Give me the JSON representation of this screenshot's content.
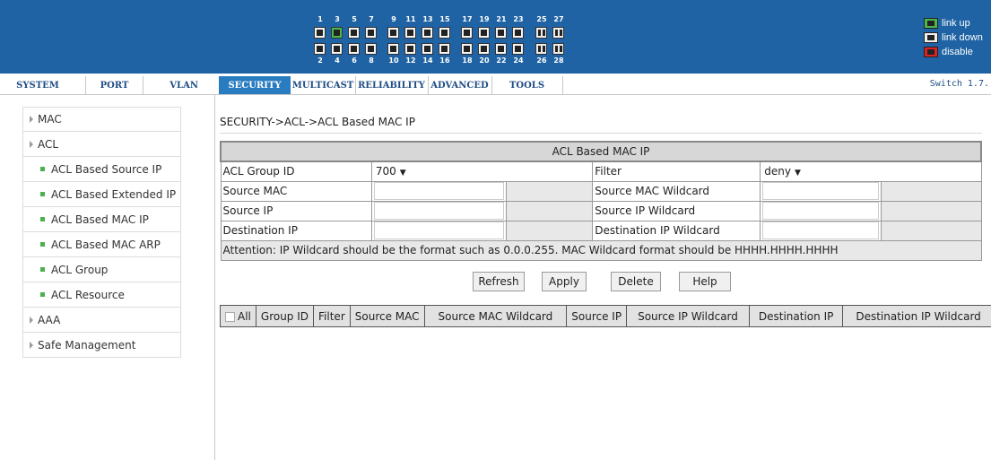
{
  "ports": {
    "top_numbers": [
      "1",
      "3",
      "5",
      "7",
      "9",
      "11",
      "13",
      "15",
      "17",
      "19",
      "21",
      "23",
      "25",
      "27"
    ],
    "bottom_numbers": [
      "2",
      "4",
      "6",
      "8",
      "10",
      "12",
      "14",
      "16",
      "18",
      "20",
      "22",
      "24",
      "26",
      "28"
    ],
    "link_up_ports": [
      "3"
    ]
  },
  "legend": {
    "up": "link up",
    "down": "link down",
    "disable": "disable"
  },
  "colors": {
    "banner": "#1f63a4",
    "active_tab": "#2a7cc0",
    "link_up": "#49b84d",
    "disable": "#e02121"
  },
  "nav": {
    "tabs": [
      "SYSTEM",
      "PORT",
      "VLAN",
      "SECURITY",
      "MULTICAST",
      "RELIABILITY",
      "ADVANCED",
      "TOOLS"
    ],
    "active": "SECURITY",
    "version": "Switch 1.7."
  },
  "sidebar": {
    "items": [
      "MAC",
      "ACL",
      "ACL Based Source IP",
      "ACL Based Extended IP",
      "ACL Based MAC IP",
      "ACL Based MAC ARP",
      "ACL Group",
      "ACL Resource",
      "AAA",
      "Safe Management"
    ]
  },
  "breadcrumb": "SECURITY->ACL->ACL Based MAC IP",
  "form": {
    "title": "ACL Based MAC IP",
    "group_id_label": "ACL Group ID",
    "group_id_value": "700",
    "filter_label": "Filter",
    "filter_value": "deny",
    "source_mac_label": "Source MAC",
    "source_mac_wildcard_label": "Source MAC Wildcard",
    "source_ip_label": "Source IP",
    "source_ip_wildcard_label": "Source IP Wildcard",
    "destination_ip_label": "Destination IP",
    "destination_ip_wildcard_label": "Destination IP Wildcard",
    "attention": "Attention: IP Wildcard should be the format such as 0.0.0.255. MAC Wildcard format should be HHHH.HHHH.HHHH"
  },
  "buttons": {
    "refresh": "Refresh",
    "apply": "Apply",
    "delete": "Delete",
    "help": "Help"
  },
  "list": {
    "columns": [
      "All",
      "Group ID",
      "Filter",
      "Source MAC",
      "Source MAC Wildcard",
      "Source IP",
      "Source IP Wildcard",
      "Destination IP",
      "Destination IP Wildcard"
    ]
  }
}
